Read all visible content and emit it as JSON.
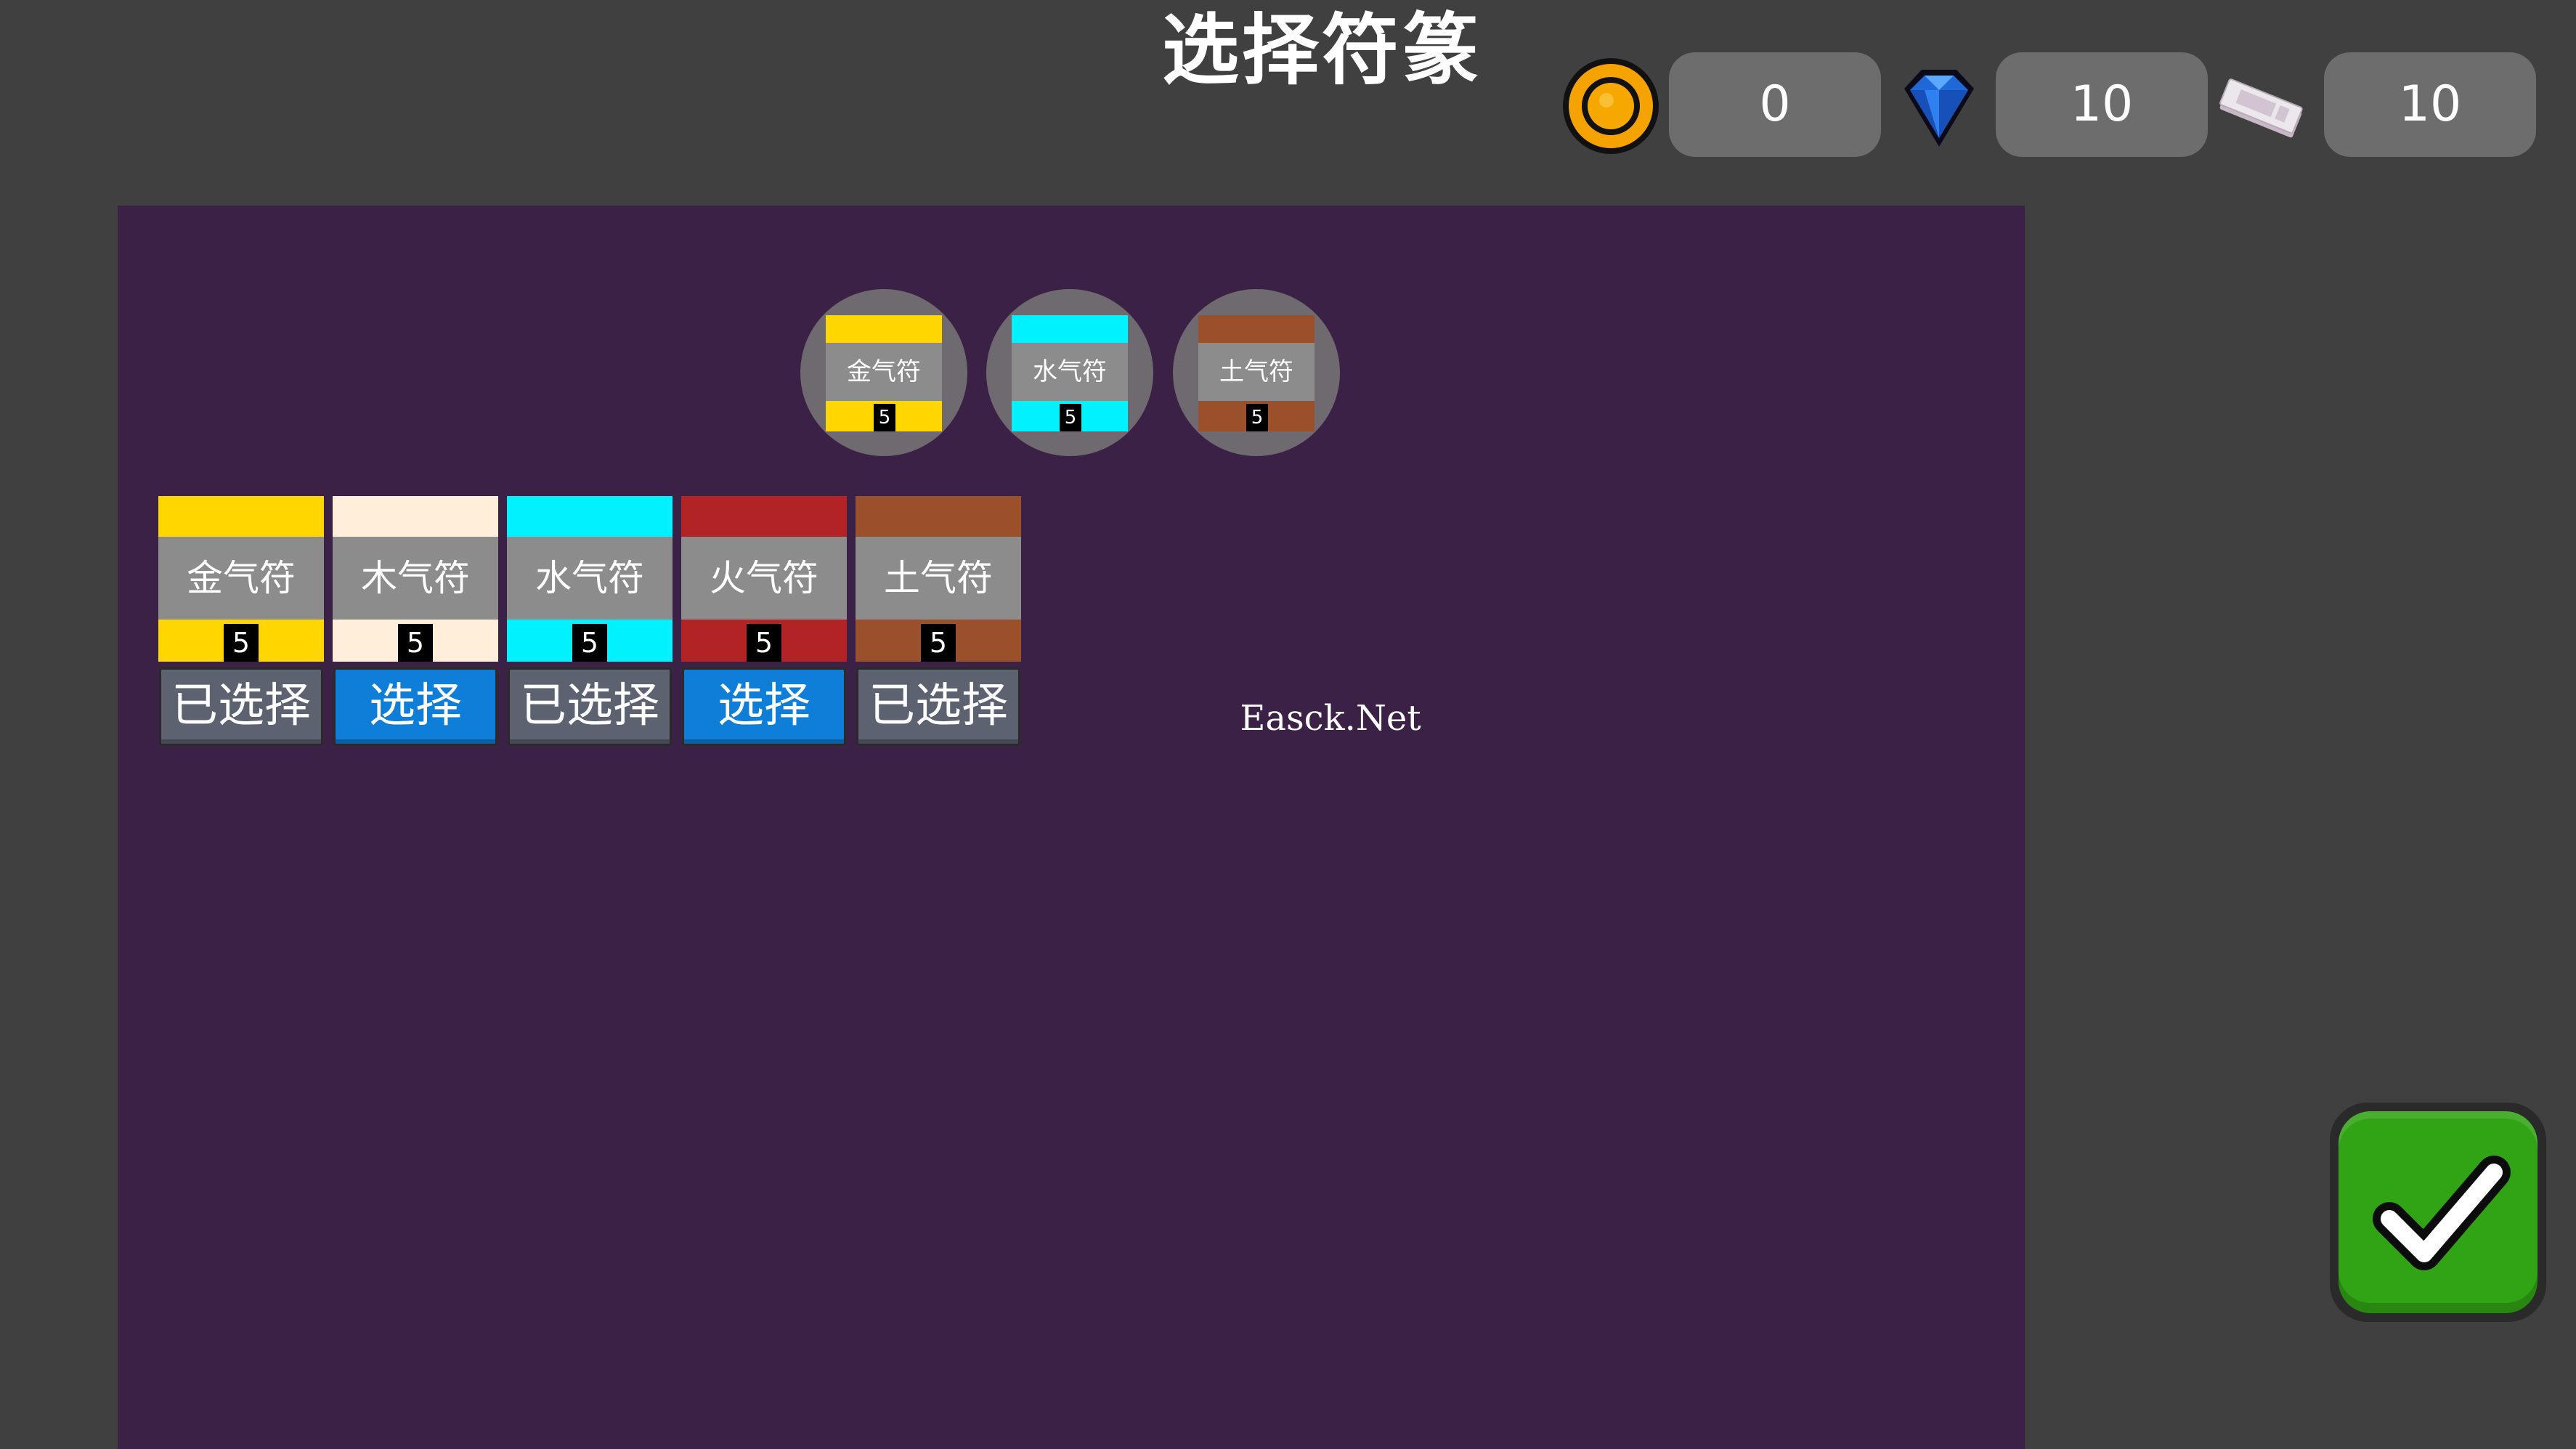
{
  "header": {
    "title": "选择符篆"
  },
  "currencies": {
    "gold": {
      "icon": "coin-icon",
      "value": "0",
      "color": "#f5a300"
    },
    "diamond": {
      "icon": "diamond-icon",
      "value": "10",
      "color": "#1e68d8"
    },
    "ticket": {
      "icon": "ticket-icon",
      "value": "10"
    }
  },
  "selected_slots": [
    {
      "label": "金气符",
      "count": "5",
      "color": "#ffd600"
    },
    {
      "label": "水气符",
      "count": "5",
      "color": "#00f2ff"
    },
    {
      "label": "土气符",
      "count": "5",
      "color": "#9a512b"
    }
  ],
  "talismans": [
    {
      "label": "金气符",
      "count": "5",
      "color": "#ffd600",
      "button": "已选择",
      "state": "selected"
    },
    {
      "label": "木气符",
      "count": "5",
      "color": "#ffeed9",
      "button": "选择",
      "state": "available"
    },
    {
      "label": "水气符",
      "count": "5",
      "color": "#00f2ff",
      "button": "已选择",
      "state": "selected"
    },
    {
      "label": "火气符",
      "count": "5",
      "color": "#b22325",
      "button": "选择",
      "state": "available"
    },
    {
      "label": "土气符",
      "count": "5",
      "color": "#9a512b",
      "button": "已选择",
      "state": "selected"
    }
  ],
  "watermark": "Easck.Net",
  "confirm": {
    "icon": "checkmark-icon",
    "color": "#31a415"
  },
  "colors": {
    "background": "#404040",
    "panel": "#3c2147",
    "button_selected": "#5c626f",
    "button_available": "#0f7ed9"
  }
}
